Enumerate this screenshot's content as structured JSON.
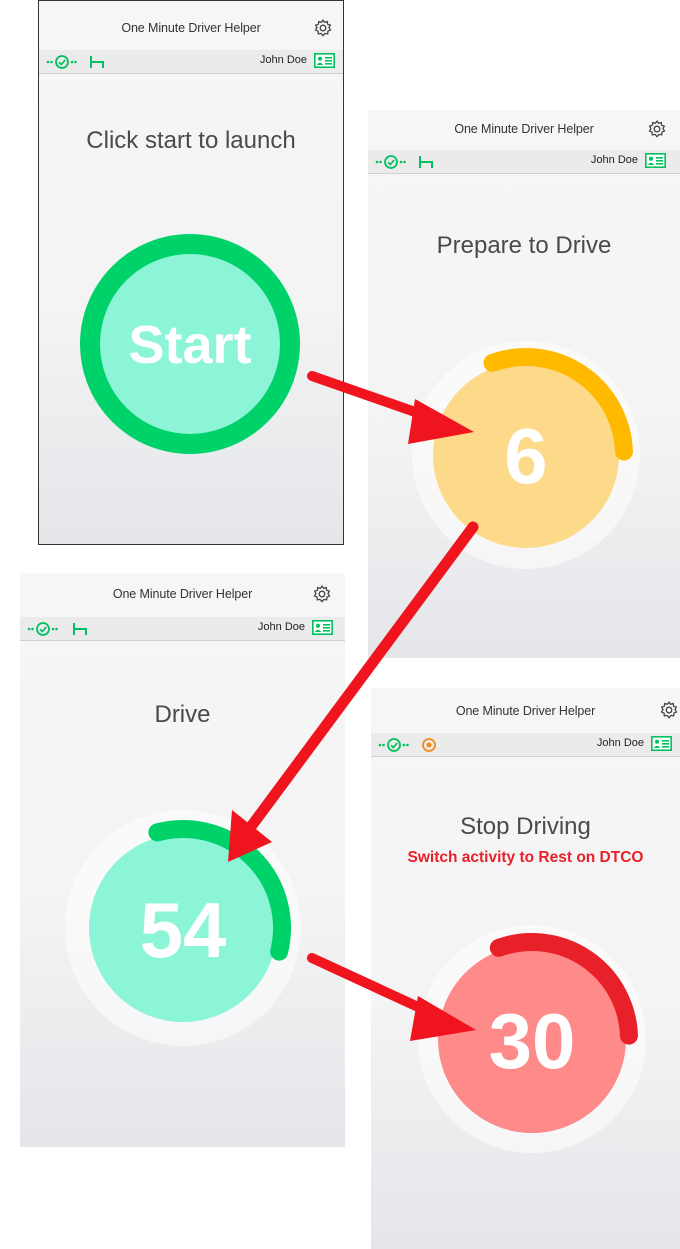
{
  "app_title": "One Minute Driver Helper",
  "user_name": "John Doe",
  "colors": {
    "green": "#00d26a",
    "mint": "#8cf5d8",
    "amber": "#ffba00",
    "sand": "#fdd98a",
    "red": "#e8202a",
    "pink": "#ff8a8a",
    "arrow": "#f0141e",
    "orange_status": "#f08a1c"
  },
  "screens": [
    {
      "heading": "Click start to launch",
      "dial_label": "Start",
      "status_icons": [
        "drive-icon",
        "bed-icon"
      ]
    },
    {
      "heading": "Prepare to Drive",
      "dial_label": "6",
      "progress": 0.3,
      "status_icons": [
        "drive-icon",
        "bed-icon"
      ]
    },
    {
      "heading": "Drive",
      "dial_label": "54",
      "progress": 0.33,
      "status_icons": [
        "drive-icon",
        "bed-icon"
      ]
    },
    {
      "heading": "Stop Driving",
      "warning": "Switch activity to Rest on DTCO",
      "dial_label": "30",
      "progress": 0.3,
      "status_icons": [
        "drive-icon",
        "target-icon"
      ]
    }
  ]
}
